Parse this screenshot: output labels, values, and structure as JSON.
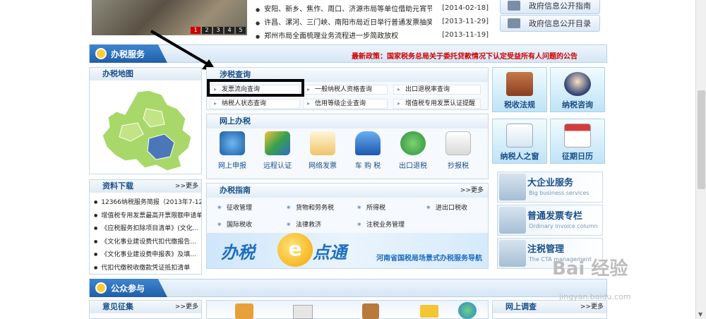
{
  "photo": {
    "pages": [
      "1",
      "2",
      "3",
      "4",
      "5"
    ]
  },
  "news": [
    {
      "text": "安阳、新乡、焦作、周口、济源市局等单位借助元宵节、...",
      "date": "[2014-02-18]"
    },
    {
      "text": "许昌、漯河、三门峡、南阳市局近日举行普通发票抽奖仪...",
      "date": "[2013-11-29]"
    },
    {
      "text": "郑州市局全面梳理业务流程进一步简政放权",
      "date": "[2013-11-19]"
    }
  ],
  "gov_buttons": [
    "政府信息公开指南",
    "政府信息公开目录"
  ],
  "section_tax": {
    "title": "办税服务"
  },
  "notice": "最新政策：国家税务总局关于委托贷款情况下认定受益所有人问题的公告",
  "map_panel": {
    "title": "办税地图"
  },
  "download_panel": {
    "title": "资料下载",
    "more": ">>更多",
    "items": [
      "12366纳税服务简报（2013年7-12...",
      "增值税专用发票最高开票限额申请单",
      "《应税服务扣除项目清单》(文化...",
      "《文化事业建设费代扣代缴报告...",
      "《文化事业建设费申报表》及填...",
      "代扣代缴税收缴款凭证抵扣清单"
    ]
  },
  "query_box": {
    "title": "涉税查询",
    "items": [
      "发票流向查询",
      "一般纳税人资格查询",
      "出口退税率查询",
      "纳税人状态查询",
      "信用等级企业查询",
      "增值税专用发票认证提醒"
    ]
  },
  "online_box": {
    "title": "网上办税",
    "items": [
      "网上申报",
      "远程认证",
      "网络发票",
      "车 购 税",
      "出口退税",
      "抄报税"
    ]
  },
  "guide_box": {
    "title": "办税指南",
    "more": ">>更多",
    "items": [
      "征收管理",
      "货物和劳务税",
      "所得税",
      "进出口税收",
      "国际税收",
      "法律救济",
      "注税业务管理"
    ]
  },
  "banner": {
    "left": "办税",
    "mid": "e",
    "right": "点通",
    "caption": "河南省国税局场景式办税服务导航"
  },
  "tiles": [
    "税收法规",
    "纳税咨询",
    "纳税人之窗",
    "征期日历"
  ],
  "services": [
    {
      "title": "大企业服务",
      "sub": "Big business services"
    },
    {
      "title": "普通发票专栏",
      "sub": "Ordinary invoice column"
    },
    {
      "title": "注税管理",
      "sub": "The CTA management"
    }
  ],
  "section_public": {
    "title": "公众参与"
  },
  "opinion_panel": {
    "title": "意见征集",
    "more": ">>更多"
  },
  "survey_panel": {
    "title": "网上调查",
    "more": ">>更多"
  },
  "watermark": {
    "logo": "Bai 经验",
    "url": "jingyan.baidu.com"
  },
  "colors": {
    "accent": "#1f5fa8",
    "notice": "#d00000",
    "highlight": "#000000"
  }
}
